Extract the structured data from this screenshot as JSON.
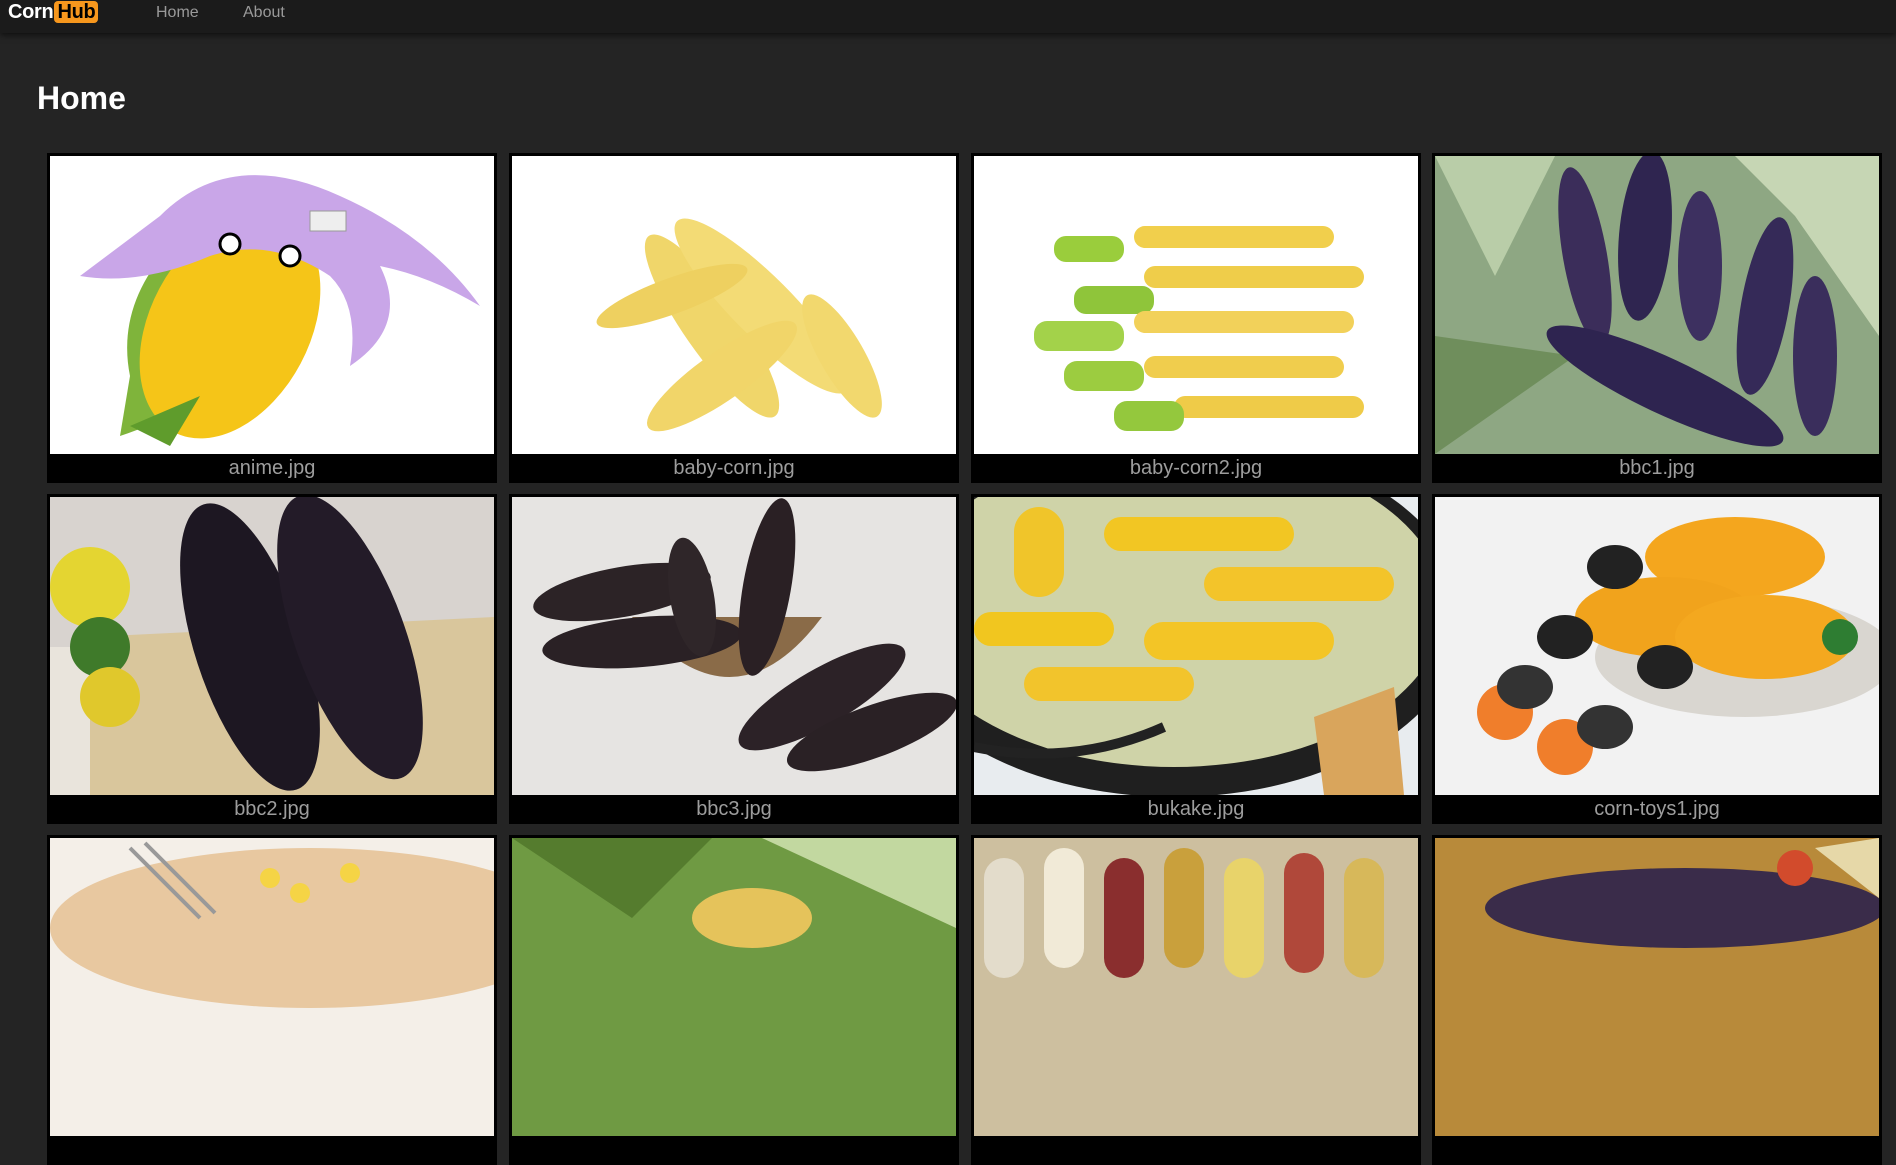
{
  "brand": {
    "part1": "Corn",
    "part2": "Hub"
  },
  "nav": {
    "home": "Home",
    "about": "About"
  },
  "page_title": "Home",
  "images": [
    {
      "caption": "anime.jpg",
      "icon": "anime-corn-image"
    },
    {
      "caption": "baby-corn.jpg",
      "icon": "baby-corn-image"
    },
    {
      "caption": "baby-corn2.jpg",
      "icon": "baby-corn-image"
    },
    {
      "caption": "bbc1.jpg",
      "icon": "purple-corn-image"
    },
    {
      "caption": "bbc2.jpg",
      "icon": "black-corn-image"
    },
    {
      "caption": "bbc3.jpg",
      "icon": "black-corn-image"
    },
    {
      "caption": "bukake.jpg",
      "icon": "corn-in-pot-image"
    },
    {
      "caption": "corn-toys1.jpg",
      "icon": "corn-holders-image"
    },
    {
      "caption": "",
      "icon": "corn-dish-image"
    },
    {
      "caption": "",
      "icon": "corn-plant-image"
    },
    {
      "caption": "",
      "icon": "colorful-corn-image"
    },
    {
      "caption": "",
      "icon": "corn-cob-image"
    }
  ]
}
